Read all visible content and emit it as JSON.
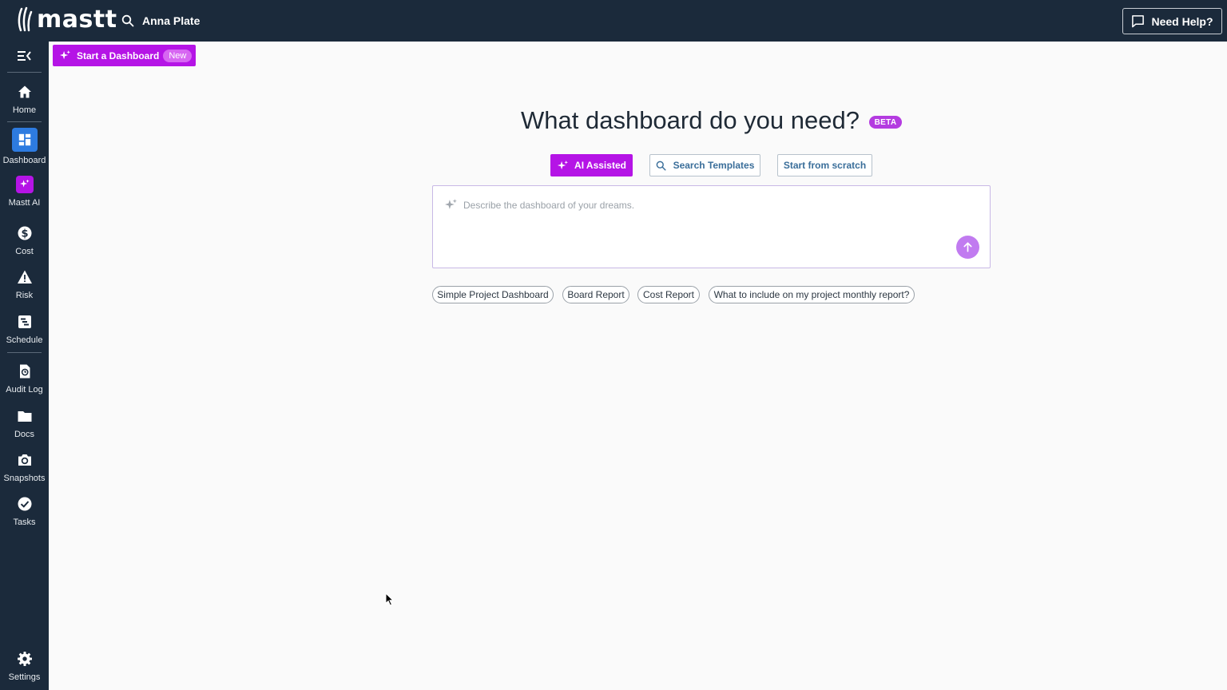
{
  "app": {
    "logo_text": "mastt",
    "project_name": "Anna Plate",
    "help_label": "Need Help?"
  },
  "sidebar": {
    "items": [
      {
        "label": "Home",
        "icon": "home-icon"
      },
      {
        "label": "Dashboard",
        "icon": "dashboard-icon",
        "active": true
      },
      {
        "label": "Mastt AI",
        "icon": "sparkle-icon"
      },
      {
        "label": "Cost",
        "icon": "dollar-icon"
      },
      {
        "label": "Risk",
        "icon": "warning-icon"
      },
      {
        "label": "Schedule",
        "icon": "schedule-icon"
      },
      {
        "label": "Audit Log",
        "icon": "audit-log-icon"
      },
      {
        "label": "Docs",
        "icon": "folder-icon"
      },
      {
        "label": "Snapshots",
        "icon": "camera-icon"
      },
      {
        "label": "Tasks",
        "icon": "check-circle-icon"
      },
      {
        "label": "Settings",
        "icon": "gear-icon"
      }
    ]
  },
  "start_dashboard": {
    "label": "Start a Dashboard",
    "badge": "New"
  },
  "main": {
    "headline": "What dashboard do you need?",
    "beta_badge": "BETA",
    "modes": {
      "ai": "AI Assisted",
      "search": "Search Templates",
      "scratch": "Start from scratch"
    },
    "prompt": {
      "placeholder": "Describe the dashboard of your dreams.",
      "value": ""
    },
    "suggestions": [
      "Simple Project Dashboard",
      "Board Report",
      "Cost Report",
      "What to include on my project monthly report?"
    ]
  },
  "colors": {
    "topbar_bg": "#1b2a3b",
    "accent_purple": "#b514e6",
    "active_blue": "#2d7be0",
    "send_button": "#c17bf0",
    "canvas_bg": "#fafafa"
  }
}
